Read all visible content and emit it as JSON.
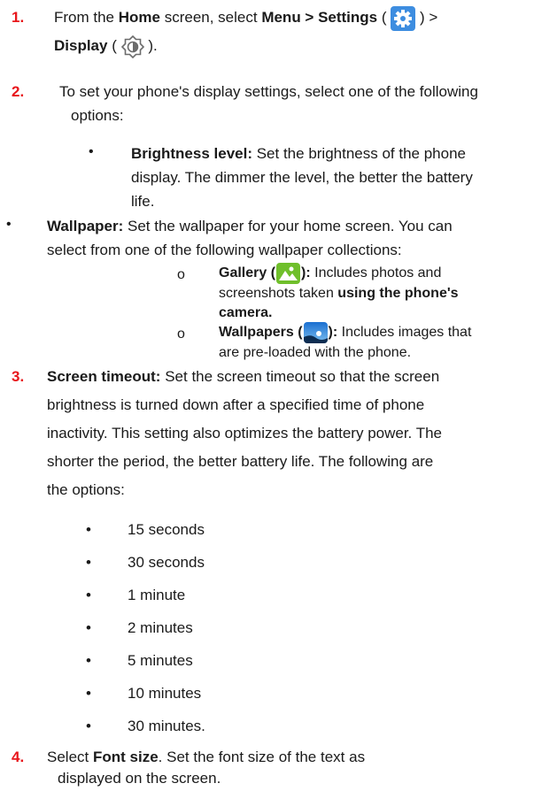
{
  "step1": {
    "num": "1.",
    "t1": "From the ",
    "home": "Home",
    "t2": " screen, select ",
    "menu_settings": "Menu > Settings",
    "t3": " ( ",
    "t4": " ) >",
    "display": "Display",
    "t5": " ( ",
    "t6": " )."
  },
  "step2": {
    "num": "2.",
    "line1": "To set your phone's display settings, select one of the following",
    "line2": "options:",
    "brightness": {
      "label": "Brightness level:",
      "l1": " Set the brightness of the phone",
      "l2": "display. The dimmer the level, the better the battery",
      "l3": "life."
    },
    "wallpaper": {
      "label": "Wallpaper:",
      "l1": "  Set the wallpaper for your home screen. You can",
      "l2": "select from one of the following wallpaper collections:",
      "gallery": {
        "marker": "o",
        "label": "Gallery (",
        "label_end": "):",
        "l1": " Includes photos and",
        "l2": "screenshots taken ",
        "l2b": "using the phone's",
        "l3": "camera."
      },
      "wallpapers": {
        "marker": "o",
        "label": "Wallpapers (",
        "label_end": "):",
        "l1": " Includes images that",
        "l2": "are pre-loaded with the phone."
      }
    }
  },
  "step3": {
    "num": "3.",
    "label": "Screen timeout:",
    "l1": " Set the screen timeout so that the screen",
    "l2": "brightness is turned down after a specified time of phone",
    "l3": "inactivity. This setting also optimizes the battery power. The",
    "l4": "shorter the period, the better battery life. The following are",
    "l5": "the options:",
    "options": [
      "15 seconds",
      "30 seconds",
      "1 minute",
      "2 minutes",
      "5 minutes",
      "10 minutes",
      "30 minutes."
    ]
  },
  "step4": {
    "num": "4.",
    "t1": "Select ",
    "font_size": "Font size",
    "t2": ". Set the font size of the text as",
    "l2": "displayed on the screen."
  },
  "bullet": "•",
  "colors": {
    "accent_red": "#e8161b",
    "settings_icon_bg": "#3d8de0",
    "gallery_icon_bg": "#6fbf2b",
    "wallpapers_icon_bg": "#2f7fd8"
  },
  "icons": {
    "settings": "gear-icon",
    "display": "brightness-icon",
    "gallery": "gallery-icon",
    "wallpapers": "wallpapers-icon"
  }
}
